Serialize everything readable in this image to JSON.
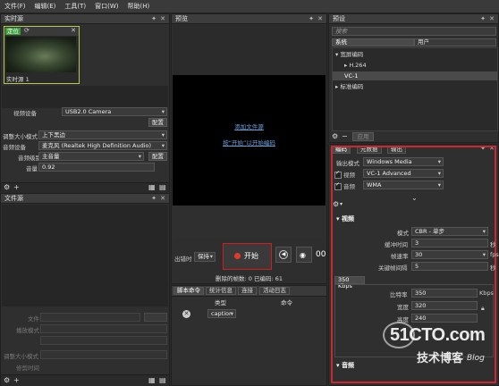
{
  "menu": [
    "文件(F)",
    "编辑(E)",
    "工具(T)",
    "窗口(W)",
    "帮助(H)"
  ],
  "live_source": {
    "title": "实时源",
    "thumb_badge": "定位",
    "thumb_label": "实时源 1",
    "video_device_label": "视频设备",
    "video_device_value": "USB2.0 Camera",
    "config_button": "配置",
    "resize_mode_label": "调整大小模式",
    "resize_mode_value": "上下黑边",
    "audio_device_label": "音频设备",
    "audio_device_value": "麦克风 (Realtek High Definition Audio)",
    "audio_level_label": "音频级别",
    "audio_level_value": "主音量",
    "audio_config_button": "配置",
    "volume_label": "音量",
    "volume_value": "0.92"
  },
  "file_source": {
    "title": "文件源",
    "file_label": "文件",
    "loop_label": "播放模式",
    "resize_label": "调整大小模式",
    "cut_label": "修剪时间"
  },
  "preview": {
    "title": "预览",
    "link1": "添加文件源",
    "link2": "按“开始”以开始编码",
    "timer_label": "出错时",
    "timer_value": "保持",
    "start_button": "开始",
    "dropped_frames": "删除的帧数: 0 已编码: 61",
    "time_partial": "00"
  },
  "script_panel": {
    "tabs": [
      "脚本命令",
      "统计信息",
      "连接",
      "活动日志"
    ],
    "col_type": "类型",
    "col_cmd": "命令",
    "row_value": "caption"
  },
  "presets": {
    "title": "预设",
    "search_placeholder": "搜索",
    "tabs": [
      "系统",
      "用户"
    ],
    "tree": [
      {
        "label": "▾ 宽屏编码",
        "indent": 0
      },
      {
        "label": "▸ H.264",
        "indent": 1
      },
      {
        "label": "VC-1",
        "indent": 1,
        "selected": true
      },
      {
        "label": "▸ 标准编码",
        "indent": 0
      }
    ],
    "apply_button": "应用"
  },
  "encoding": {
    "tabs": [
      "编码",
      "元数据",
      "输出"
    ],
    "output_mode_label": "输出模式",
    "output_mode_value": "Windows Media",
    "video_label": "视频",
    "video_codec": "VC-1 Advanced",
    "audio_label": "音频",
    "audio_codec": "WMA",
    "video_section": "▾ 视频",
    "mode_label": "模式",
    "mode_value": "CBR - 单步",
    "buffer_label": "缓冲时间",
    "buffer_value": "3",
    "buffer_unit": "秒",
    "framerate_label": "帧速率",
    "framerate_value": "30",
    "framerate_unit": "fps",
    "keyframe_label": "关键帧间隔",
    "keyframe_value": "5",
    "keyframe_unit": "秒",
    "bitrate_tab": "350 Kbps",
    "bitrate_label": "比特率",
    "bitrate_value": "350",
    "bitrate_unit": "Kbps",
    "width_label": "宽度",
    "width_value": "320",
    "height_label": "高度",
    "height_value": "240",
    "audio_section": "▾ 音频"
  },
  "watermark": {
    "site": "51CTO.com",
    "sub": "技术博客",
    "blog": "Blog"
  }
}
